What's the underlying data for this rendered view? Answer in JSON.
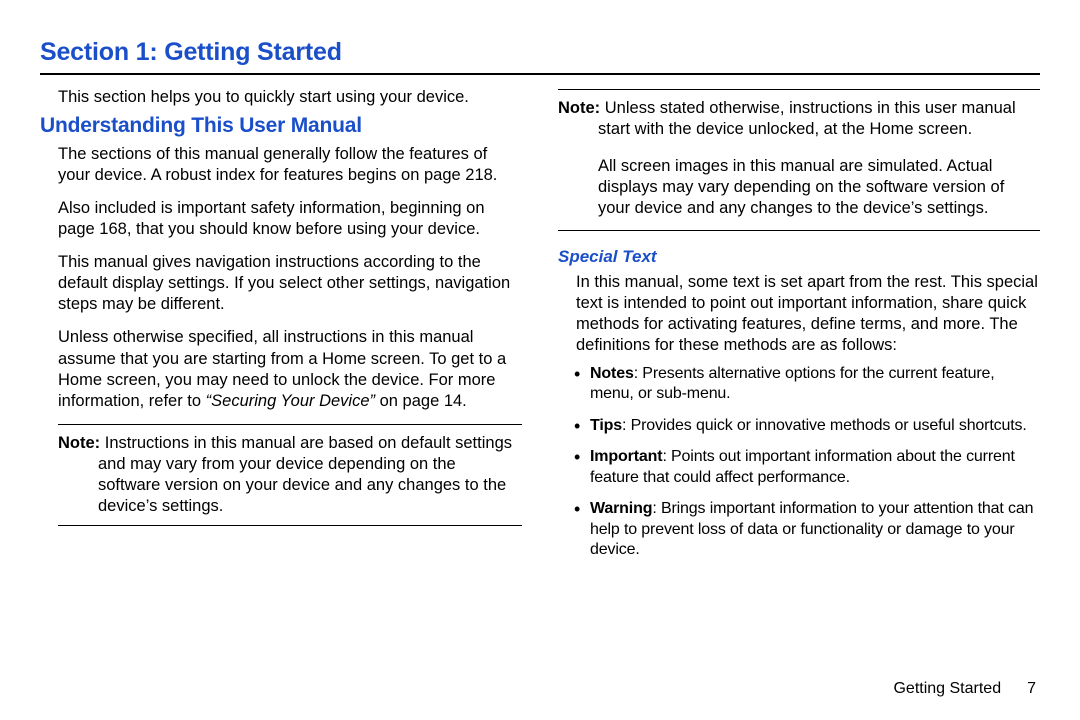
{
  "colors": {
    "accent": "#1a4fc9"
  },
  "header": {
    "sectionTitle": "Section 1: Getting Started"
  },
  "left": {
    "intro": "This section helps you to quickly start using your device.",
    "subheading": "Understanding This User Manual",
    "p1": "The sections of this manual generally follow the features of your device. A robust index for features begins on page 218.",
    "p2": "Also included is important safety information, beginning on page 168, that you should know before using your device.",
    "p3": "This manual gives navigation instructions according to the default display settings. If you select other settings, navigation steps may be different.",
    "p4a": "Unless otherwise specified, all instructions in this manual assume that you are starting from a Home screen. To get to a Home screen, you may need to unlock the device. For more information, refer to ",
    "p4ref": "“Securing Your Device”",
    "p4b": " on page 14.",
    "note1_label": "Note:",
    "note1_text": " Instructions in this manual are based on default settings and may vary from your device depending on the software version on your device and any changes to the device’s settings."
  },
  "right": {
    "note2_label": "Note:",
    "note2_text": " Unless stated otherwise, instructions in this user manual start with the device unlocked, at the Home screen.",
    "note2_extra": "All screen images in this manual are simulated. Actual displays may vary depending on the software version of your device and any changes to the device’s settings.",
    "specialHeading": "Special Text",
    "specialIntro": "In this manual, some text is set apart from the rest. This special text is intended to point out important information, share quick methods for activating features, define terms, and more. The definitions for these methods are as follows:",
    "bullets": [
      {
        "label": "Notes",
        "text": ": Presents alternative options for the current feature, menu, or sub-menu."
      },
      {
        "label": "Tips",
        "text": ": Provides quick or innovative methods or useful shortcuts."
      },
      {
        "label": "Important",
        "text": ": Points out important information about the current feature that could affect performance."
      },
      {
        "label": "Warning",
        "text": ": Brings important information to your attention that can help to prevent loss of data or functionality or damage to your device."
      }
    ]
  },
  "footer": {
    "chapter": "Getting Started",
    "page": "7"
  }
}
